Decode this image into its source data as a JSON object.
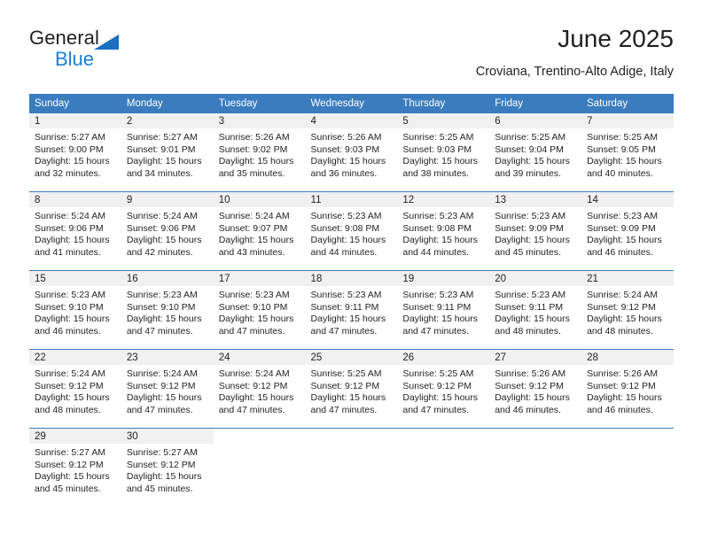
{
  "brand": {
    "name_top": "General",
    "name_bottom": "Blue",
    "triangle_color": "#1b6ec2",
    "blue_text_color": "#1b7fd4"
  },
  "header": {
    "title": "June 2025",
    "subtitle": "Croviana, Trentino-Alto Adige, Italy"
  },
  "theme": {
    "header_row_bg": "#3a7cbe",
    "daynum_band_bg": "#f0f0f0",
    "text_color": "#231f20"
  },
  "weekday_headers": [
    "Sunday",
    "Monday",
    "Tuesday",
    "Wednesday",
    "Thursday",
    "Friday",
    "Saturday"
  ],
  "weeks": [
    [
      {
        "day": "1",
        "sunrise": "Sunrise: 5:27 AM",
        "sunset": "Sunset: 9:00 PM",
        "daylight1": "Daylight: 15 hours",
        "daylight2": "and 32 minutes."
      },
      {
        "day": "2",
        "sunrise": "Sunrise: 5:27 AM",
        "sunset": "Sunset: 9:01 PM",
        "daylight1": "Daylight: 15 hours",
        "daylight2": "and 34 minutes."
      },
      {
        "day": "3",
        "sunrise": "Sunrise: 5:26 AM",
        "sunset": "Sunset: 9:02 PM",
        "daylight1": "Daylight: 15 hours",
        "daylight2": "and 35 minutes."
      },
      {
        "day": "4",
        "sunrise": "Sunrise: 5:26 AM",
        "sunset": "Sunset: 9:03 PM",
        "daylight1": "Daylight: 15 hours",
        "daylight2": "and 36 minutes."
      },
      {
        "day": "5",
        "sunrise": "Sunrise: 5:25 AM",
        "sunset": "Sunset: 9:03 PM",
        "daylight1": "Daylight: 15 hours",
        "daylight2": "and 38 minutes."
      },
      {
        "day": "6",
        "sunrise": "Sunrise: 5:25 AM",
        "sunset": "Sunset: 9:04 PM",
        "daylight1": "Daylight: 15 hours",
        "daylight2": "and 39 minutes."
      },
      {
        "day": "7",
        "sunrise": "Sunrise: 5:25 AM",
        "sunset": "Sunset: 9:05 PM",
        "daylight1": "Daylight: 15 hours",
        "daylight2": "and 40 minutes."
      }
    ],
    [
      {
        "day": "8",
        "sunrise": "Sunrise: 5:24 AM",
        "sunset": "Sunset: 9:06 PM",
        "daylight1": "Daylight: 15 hours",
        "daylight2": "and 41 minutes."
      },
      {
        "day": "9",
        "sunrise": "Sunrise: 5:24 AM",
        "sunset": "Sunset: 9:06 PM",
        "daylight1": "Daylight: 15 hours",
        "daylight2": "and 42 minutes."
      },
      {
        "day": "10",
        "sunrise": "Sunrise: 5:24 AM",
        "sunset": "Sunset: 9:07 PM",
        "daylight1": "Daylight: 15 hours",
        "daylight2": "and 43 minutes."
      },
      {
        "day": "11",
        "sunrise": "Sunrise: 5:23 AM",
        "sunset": "Sunset: 9:08 PM",
        "daylight1": "Daylight: 15 hours",
        "daylight2": "and 44 minutes."
      },
      {
        "day": "12",
        "sunrise": "Sunrise: 5:23 AM",
        "sunset": "Sunset: 9:08 PM",
        "daylight1": "Daylight: 15 hours",
        "daylight2": "and 44 minutes."
      },
      {
        "day": "13",
        "sunrise": "Sunrise: 5:23 AM",
        "sunset": "Sunset: 9:09 PM",
        "daylight1": "Daylight: 15 hours",
        "daylight2": "and 45 minutes."
      },
      {
        "day": "14",
        "sunrise": "Sunrise: 5:23 AM",
        "sunset": "Sunset: 9:09 PM",
        "daylight1": "Daylight: 15 hours",
        "daylight2": "and 46 minutes."
      }
    ],
    [
      {
        "day": "15",
        "sunrise": "Sunrise: 5:23 AM",
        "sunset": "Sunset: 9:10 PM",
        "daylight1": "Daylight: 15 hours",
        "daylight2": "and 46 minutes."
      },
      {
        "day": "16",
        "sunrise": "Sunrise: 5:23 AM",
        "sunset": "Sunset: 9:10 PM",
        "daylight1": "Daylight: 15 hours",
        "daylight2": "and 47 minutes."
      },
      {
        "day": "17",
        "sunrise": "Sunrise: 5:23 AM",
        "sunset": "Sunset: 9:10 PM",
        "daylight1": "Daylight: 15 hours",
        "daylight2": "and 47 minutes."
      },
      {
        "day": "18",
        "sunrise": "Sunrise: 5:23 AM",
        "sunset": "Sunset: 9:11 PM",
        "daylight1": "Daylight: 15 hours",
        "daylight2": "and 47 minutes."
      },
      {
        "day": "19",
        "sunrise": "Sunrise: 5:23 AM",
        "sunset": "Sunset: 9:11 PM",
        "daylight1": "Daylight: 15 hours",
        "daylight2": "and 47 minutes."
      },
      {
        "day": "20",
        "sunrise": "Sunrise: 5:23 AM",
        "sunset": "Sunset: 9:11 PM",
        "daylight1": "Daylight: 15 hours",
        "daylight2": "and 48 minutes."
      },
      {
        "day": "21",
        "sunrise": "Sunrise: 5:24 AM",
        "sunset": "Sunset: 9:12 PM",
        "daylight1": "Daylight: 15 hours",
        "daylight2": "and 48 minutes."
      }
    ],
    [
      {
        "day": "22",
        "sunrise": "Sunrise: 5:24 AM",
        "sunset": "Sunset: 9:12 PM",
        "daylight1": "Daylight: 15 hours",
        "daylight2": "and 48 minutes."
      },
      {
        "day": "23",
        "sunrise": "Sunrise: 5:24 AM",
        "sunset": "Sunset: 9:12 PM",
        "daylight1": "Daylight: 15 hours",
        "daylight2": "and 47 minutes."
      },
      {
        "day": "24",
        "sunrise": "Sunrise: 5:24 AM",
        "sunset": "Sunset: 9:12 PM",
        "daylight1": "Daylight: 15 hours",
        "daylight2": "and 47 minutes."
      },
      {
        "day": "25",
        "sunrise": "Sunrise: 5:25 AM",
        "sunset": "Sunset: 9:12 PM",
        "daylight1": "Daylight: 15 hours",
        "daylight2": "and 47 minutes."
      },
      {
        "day": "26",
        "sunrise": "Sunrise: 5:25 AM",
        "sunset": "Sunset: 9:12 PM",
        "daylight1": "Daylight: 15 hours",
        "daylight2": "and 47 minutes."
      },
      {
        "day": "27",
        "sunrise": "Sunrise: 5:26 AM",
        "sunset": "Sunset: 9:12 PM",
        "daylight1": "Daylight: 15 hours",
        "daylight2": "and 46 minutes."
      },
      {
        "day": "28",
        "sunrise": "Sunrise: 5:26 AM",
        "sunset": "Sunset: 9:12 PM",
        "daylight1": "Daylight: 15 hours",
        "daylight2": "and 46 minutes."
      }
    ],
    [
      {
        "day": "29",
        "sunrise": "Sunrise: 5:27 AM",
        "sunset": "Sunset: 9:12 PM",
        "daylight1": "Daylight: 15 hours",
        "daylight2": "and 45 minutes."
      },
      {
        "day": "30",
        "sunrise": "Sunrise: 5:27 AM",
        "sunset": "Sunset: 9:12 PM",
        "daylight1": "Daylight: 15 hours",
        "daylight2": "and 45 minutes."
      },
      {
        "day": "",
        "sunrise": "",
        "sunset": "",
        "daylight1": "",
        "daylight2": ""
      },
      {
        "day": "",
        "sunrise": "",
        "sunset": "",
        "daylight1": "",
        "daylight2": ""
      },
      {
        "day": "",
        "sunrise": "",
        "sunset": "",
        "daylight1": "",
        "daylight2": ""
      },
      {
        "day": "",
        "sunrise": "",
        "sunset": "",
        "daylight1": "",
        "daylight2": ""
      },
      {
        "day": "",
        "sunrise": "",
        "sunset": "",
        "daylight1": "",
        "daylight2": ""
      }
    ]
  ]
}
